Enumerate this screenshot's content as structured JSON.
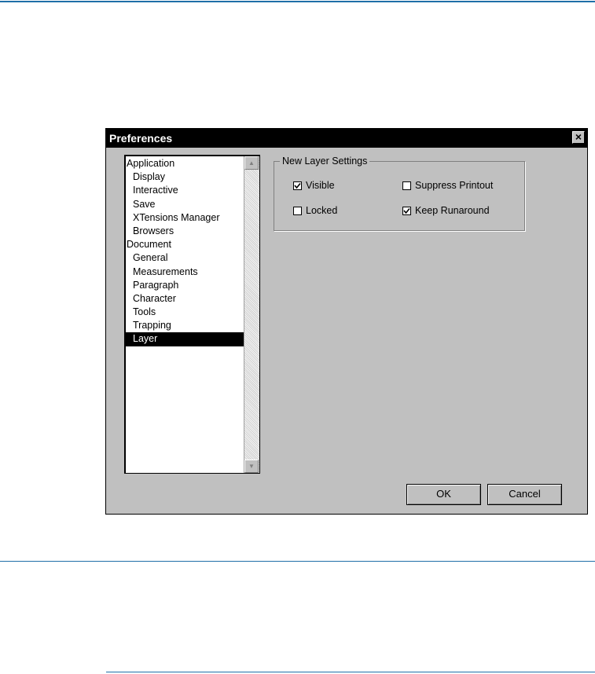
{
  "dialog": {
    "title": "Preferences",
    "close_glyph": "×"
  },
  "tree": {
    "items": [
      {
        "label": "Application",
        "level": 0,
        "selected": false
      },
      {
        "label": "Display",
        "level": 1,
        "selected": false
      },
      {
        "label": "Interactive",
        "level": 1,
        "selected": false
      },
      {
        "label": "Save",
        "level": 1,
        "selected": false
      },
      {
        "label": "XTensions Manager",
        "level": 1,
        "selected": false
      },
      {
        "label": "Browsers",
        "level": 1,
        "selected": false
      },
      {
        "label": "Document",
        "level": 0,
        "selected": false
      },
      {
        "label": "General",
        "level": 1,
        "selected": false
      },
      {
        "label": "Measurements",
        "level": 1,
        "selected": false
      },
      {
        "label": "Paragraph",
        "level": 1,
        "selected": false
      },
      {
        "label": "Character",
        "level": 1,
        "selected": false
      },
      {
        "label": "Tools",
        "level": 1,
        "selected": false
      },
      {
        "label": "Trapping",
        "level": 1,
        "selected": false
      },
      {
        "label": "Layer",
        "level": 1,
        "selected": true
      }
    ]
  },
  "layer_settings": {
    "legend": "New Layer Settings",
    "visible": {
      "label": "Visible",
      "checked": true
    },
    "suppress_printout": {
      "label": "Suppress Printout",
      "checked": false
    },
    "locked": {
      "label": "Locked",
      "checked": false
    },
    "keep_runaround": {
      "label": "Keep Runaround",
      "checked": true
    }
  },
  "buttons": {
    "ok": "OK",
    "cancel": "Cancel"
  },
  "colors": {
    "rule": "#1f6fa8",
    "dialog_bg": "#c0c0c0",
    "titlebar": "#000000",
    "selection": "#000000"
  }
}
